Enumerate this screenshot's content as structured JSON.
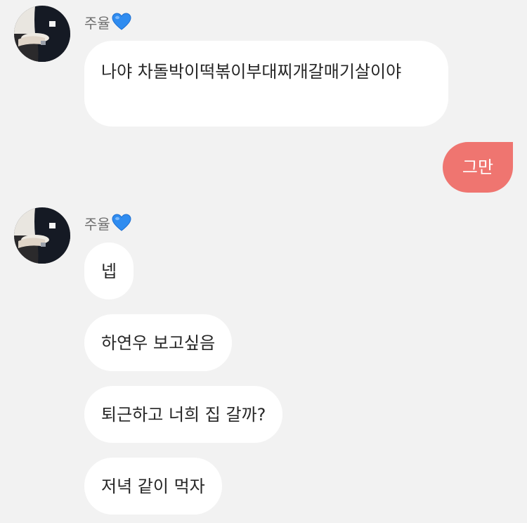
{
  "chat": {
    "sender_name": "주율",
    "heart_icon": "blue-heart-emoji",
    "colors": {
      "background": "#f2f2f2",
      "incoming_bubble": "#ffffff",
      "outgoing_bubble": "#ef7570",
      "sender_name": "#6f6f6f"
    },
    "messages": [
      {
        "direction": "incoming",
        "text": "나야 차돌박이떡볶이부대찌개갈매기살이야"
      },
      {
        "direction": "outgoing",
        "text": "그만"
      },
      {
        "direction": "incoming",
        "text": "넵"
      },
      {
        "direction": "incoming",
        "text": "하연우 보고싶음"
      },
      {
        "direction": "incoming",
        "text": "퇴근하고 너희 집 갈까?"
      },
      {
        "direction": "incoming",
        "text": "저녁 같이 먹자"
      }
    ]
  }
}
